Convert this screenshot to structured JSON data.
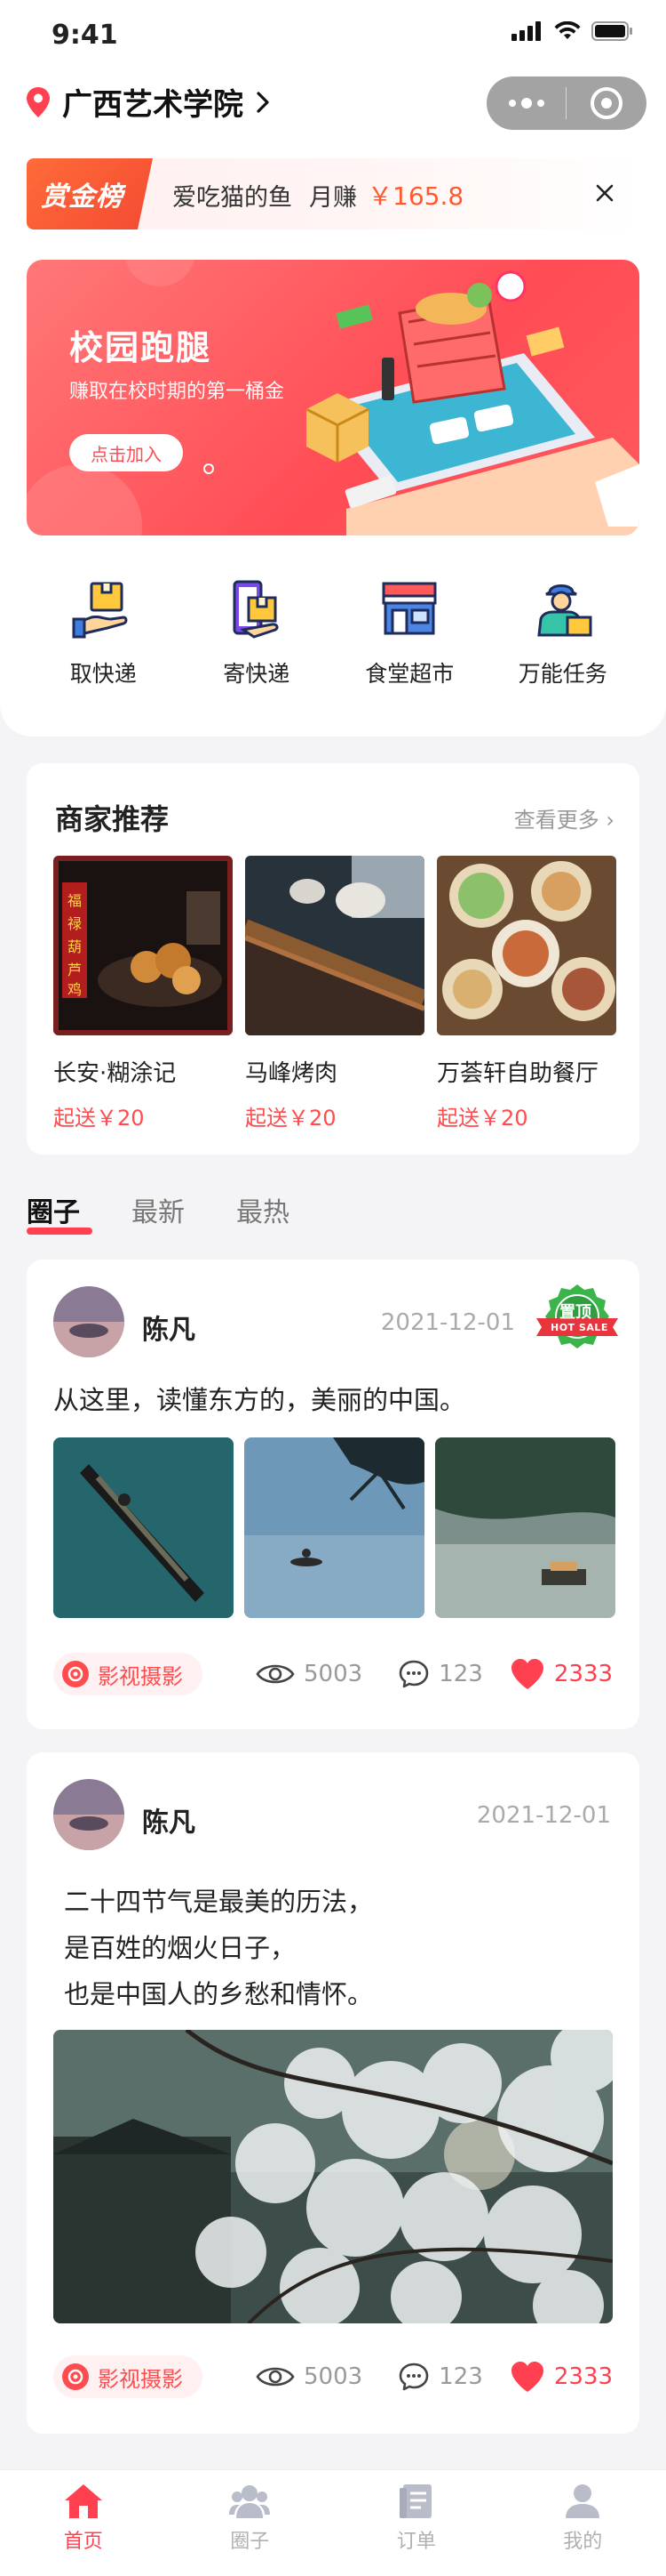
{
  "status_bar": {
    "time": "9:41"
  },
  "header": {
    "location": "广西艺术学院"
  },
  "bounty": {
    "tag": "赏金榜",
    "user": "爱吃猫的鱼",
    "earn_label": "月赚",
    "amount": "￥165.8"
  },
  "banner": {
    "title": "校园跑腿",
    "subtitle": "赚取在校时期的第一桶金",
    "button": "点击加入"
  },
  "quick_actions": [
    {
      "label": "取快递",
      "icon": "hand-package-icon"
    },
    {
      "label": "寄快递",
      "icon": "phone-package-icon"
    },
    {
      "label": "食堂超市",
      "icon": "store-icon"
    },
    {
      "label": "万能任务",
      "icon": "courier-icon"
    }
  ],
  "merchants": {
    "title": "商家推荐",
    "more": "查看更多",
    "items": [
      {
        "name": "长安·糊涂记",
        "price": "起送￥20"
      },
      {
        "name": "马峰烤肉",
        "price": "起送￥20"
      },
      {
        "name": "万荟轩自助餐厅",
        "price": "起送￥20"
      }
    ]
  },
  "feed_tabs": [
    "圈子",
    "最新",
    "最热"
  ],
  "posts": [
    {
      "user": "陈凡",
      "date": "2021-12-01",
      "badge": "置顶",
      "badge_sub": "HOT SALE",
      "text": "从这里，读懂东方的，美丽的中国。",
      "tag": "影视摄影",
      "views": "5003",
      "comments": "123",
      "likes": "2333"
    },
    {
      "user": "陈凡",
      "date": "2021-12-01",
      "text_lines": [
        "二十四节气是最美的历法，",
        "是百姓的烟火日子，",
        "也是中国人的乡愁和情怀。"
      ],
      "tag": "影视摄影",
      "views": "5003",
      "comments": "123",
      "likes": "2333"
    }
  ],
  "bottom_nav": [
    {
      "label": "首页",
      "active": true
    },
    {
      "label": "圈子",
      "active": false
    },
    {
      "label": "订单",
      "active": false
    },
    {
      "label": "我的",
      "active": false
    }
  ],
  "colors": {
    "accent": "#ff4050",
    "banner": "#ff5a5e",
    "price": "#ff4d4f",
    "bounty_amount": "#ff5a2e"
  }
}
